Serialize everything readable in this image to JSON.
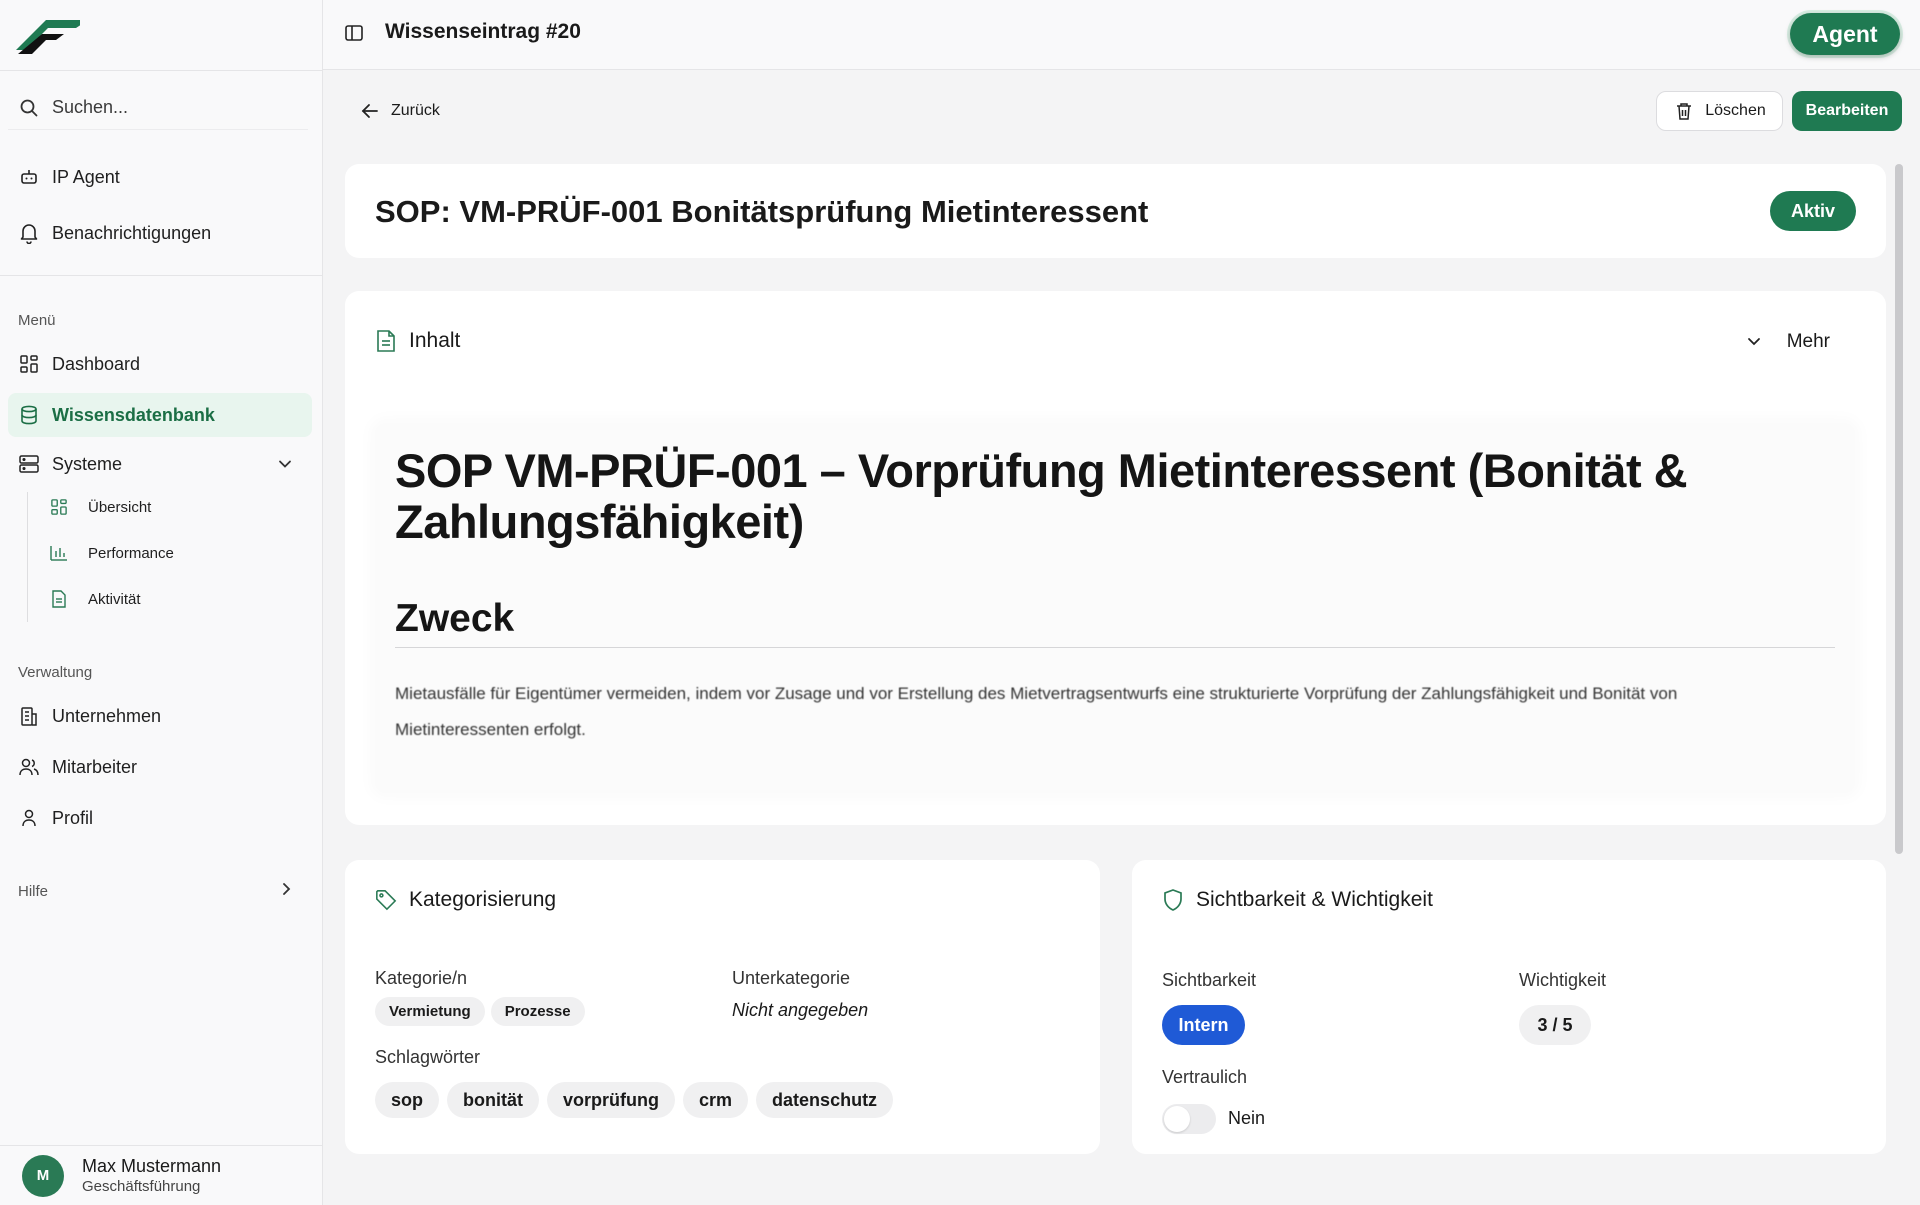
{
  "sidebar": {
    "search_placeholder": "Suchen...",
    "top_items": [
      {
        "label": "IP Agent"
      },
      {
        "label": "Benachrichtigungen"
      }
    ],
    "menu_label": "Menü",
    "menu_items": [
      {
        "label": "Dashboard"
      },
      {
        "label": "Wissensdatenbank"
      },
      {
        "label": "Systeme"
      }
    ],
    "systeme_sub": [
      {
        "label": "Übersicht"
      },
      {
        "label": "Performance"
      },
      {
        "label": "Aktivität"
      }
    ],
    "admin_label": "Verwaltung",
    "admin_items": [
      {
        "label": "Unternehmen"
      },
      {
        "label": "Mitarbeiter"
      },
      {
        "label": "Profil"
      }
    ],
    "help_label": "Hilfe",
    "user": {
      "initial": "M",
      "name": "Max Mustermann",
      "role": "Geschäftsführung"
    }
  },
  "topbar": {
    "title": "Wissenseintrag #20",
    "agent_label": "Agent"
  },
  "actions": {
    "back_label": "Zurück",
    "delete_label": "Löschen",
    "edit_label": "Bearbeiten"
  },
  "entry": {
    "title": "SOP: VM-PRÜF-001 Bonitätsprüfung Mietinteressent",
    "status": "Aktiv"
  },
  "content": {
    "header": "Inhalt",
    "more_label": "Mehr",
    "h1": "SOP VM-PRÜF-001 – Vorprüfung Mietinteressent (Bonität & Zahlungsfähigkeit)",
    "h2": "Zweck",
    "paragraph": "Mietausfälle für Eigentümer vermeiden, indem vor Zusage und vor Erstellung des Mietvertragsentwurfs eine strukturierte Vorprüfung der Zahlungsfähigkeit und Bonität von Mietinteressenten erfolgt."
  },
  "categorization": {
    "header": "Kategorisierung",
    "categories_label": "Kategorie/n",
    "categories": [
      "Vermietung",
      "Prozesse"
    ],
    "subcategory_label": "Unterkategorie",
    "subcategory_value": "Nicht angegeben",
    "tags_label": "Schlagwörter",
    "tags": [
      "sop",
      "bonität",
      "vorprüfung",
      "crm",
      "datenschutz"
    ]
  },
  "visibility": {
    "header": "Sichtbarkeit & Wichtigkeit",
    "visibility_label": "Sichtbarkeit",
    "visibility_value": "Intern",
    "importance_label": "Wichtigkeit",
    "importance_value": "3 / 5",
    "confidential_label": "Vertraulich",
    "confidential_value": "Nein",
    "confidential_on": false
  },
  "colors": {
    "brand_green": "#1f7a52",
    "active_nav_bg": "#e8f5ee",
    "intern_blue": "#1f5ad6"
  }
}
